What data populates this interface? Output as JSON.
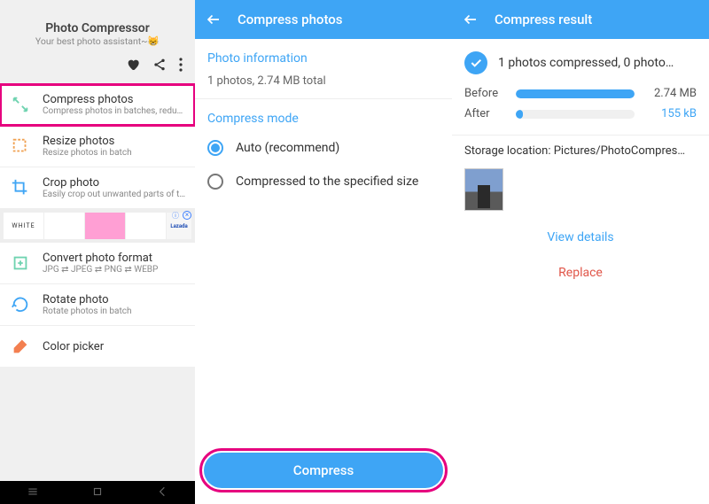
{
  "screen1": {
    "title": "Photo Compressor",
    "subtitle": "Your best photo assistant~",
    "items": [
      {
        "title": "Compress photos",
        "sub": "Compress photos in batches, reduce p…"
      },
      {
        "title": "Resize photos",
        "sub": "Resize photos in batch"
      },
      {
        "title": "Crop photo",
        "sub": "Easily crop out unwanted parts of the…"
      },
      {
        "title": "Convert photo format",
        "sub": "JPG ⇄ JPEG ⇄ PNG ⇄ WEBP"
      },
      {
        "title": "Rotate photo",
        "sub": "Rotate photos in batch"
      },
      {
        "title": "Color picker",
        "sub": ""
      }
    ],
    "ad_label": "WHITE",
    "ad_brand": "Lazada"
  },
  "screen2": {
    "header": "Compress photos",
    "section_info": "Photo information",
    "info_line": "1 photos, 2.74 MB total",
    "section_mode": "Compress mode",
    "mode_auto": "Auto (recommend)",
    "mode_size": "Compressed to the specified size",
    "compress_btn": "Compress"
  },
  "screen3": {
    "header": "Compress result",
    "result_summary": "1 photos compressed, 0 photo…",
    "before_label": "Before",
    "before_val": "2.74 MB",
    "after_label": "After",
    "after_val": "155 kB",
    "storage": "Storage location: Pictures/PhotoCompres…",
    "view_details": "View details",
    "replace": "Replace"
  }
}
